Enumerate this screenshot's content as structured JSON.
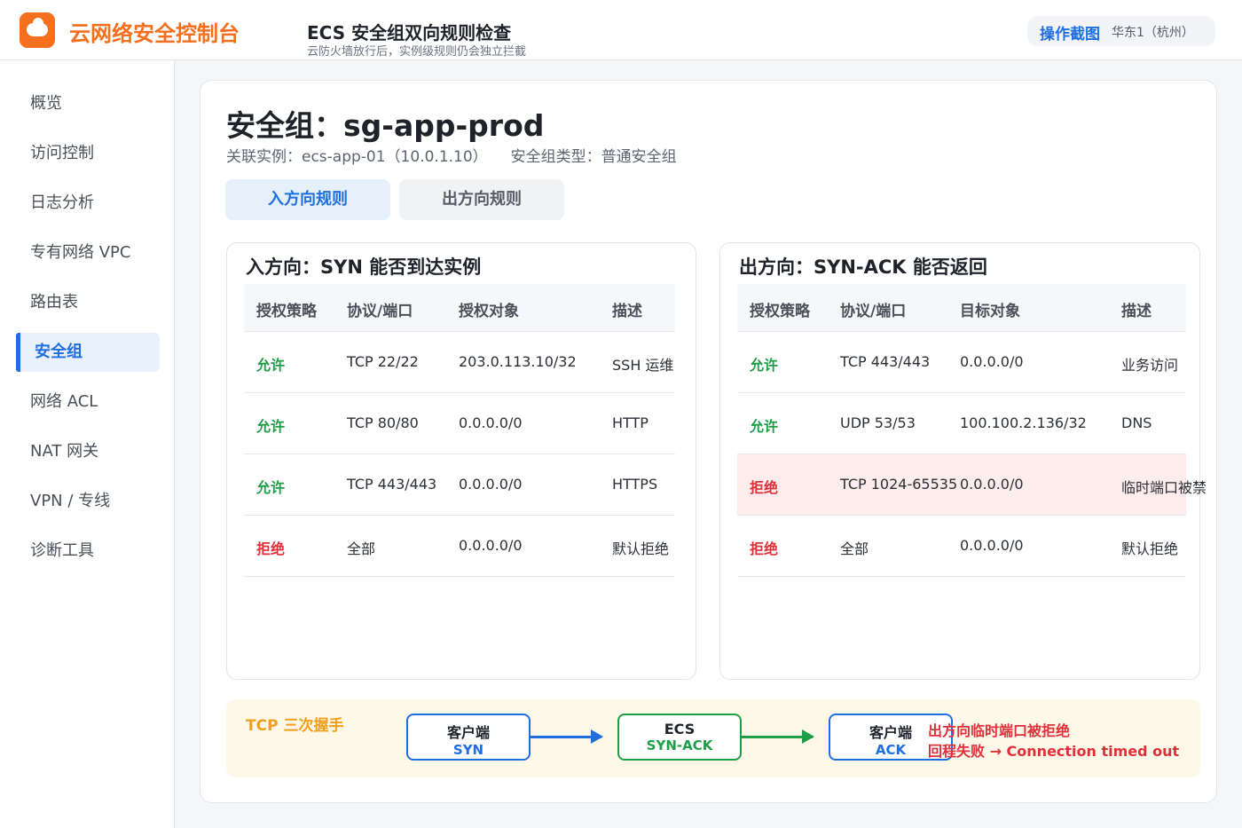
{
  "app": {
    "brand": "云网络安全控制台",
    "page_title": "ECS 安全组双向规则检查",
    "page_subtitle": "云防火墙放行后，实例级规则仍会独立拦截",
    "badge": "操作截图",
    "region": "华东1（杭州）"
  },
  "sidebar": {
    "items": [
      {
        "label": "概览",
        "active": false
      },
      {
        "label": "访问控制",
        "active": false
      },
      {
        "label": "日志分析",
        "active": false
      },
      {
        "label": "专有网络 VPC",
        "active": false
      },
      {
        "label": "路由表",
        "active": false
      },
      {
        "label": "安全组",
        "active": true
      },
      {
        "label": "网络 ACL",
        "active": false
      },
      {
        "label": "NAT 网关",
        "active": false
      },
      {
        "label": "VPN / 专线",
        "active": false
      },
      {
        "label": "诊断工具",
        "active": false
      }
    ]
  },
  "security_group": {
    "title": "安全组：sg-app-prod",
    "instance": "关联实例：ecs-app-01（10.0.1.10）",
    "type": "安全组类型：普通安全组"
  },
  "tabs": {
    "inbound": "入方向规则",
    "outbound": "出方向规则",
    "active": "inbound"
  },
  "inbound": {
    "title": "入方向：SYN 能否到达实例",
    "headers": [
      "授权策略",
      "协议/端口",
      "授权对象",
      "描述"
    ],
    "rows": [
      {
        "policy": "允许",
        "port": "TCP 22/22",
        "target": "203.0.113.10/32",
        "desc": "SSH 运维"
      },
      {
        "policy": "允许",
        "port": "TCP 80/80",
        "target": "0.0.0.0/0",
        "desc": "HTTP"
      },
      {
        "policy": "允许",
        "port": "TCP 443/443",
        "target": "0.0.0.0/0",
        "desc": "HTTPS"
      },
      {
        "policy": "拒绝",
        "port": "全部",
        "target": "0.0.0.0/0",
        "desc": "默认拒绝"
      }
    ]
  },
  "outbound": {
    "title": "出方向：SYN-ACK 能否返回",
    "headers": [
      "授权策略",
      "协议/端口",
      "目标对象",
      "描述"
    ],
    "rows": [
      {
        "policy": "允许",
        "port": "TCP 443/443",
        "target": "0.0.0.0/0",
        "desc": "业务访问"
      },
      {
        "policy": "允许",
        "port": "UDP 53/53",
        "target": "100.100.2.136/32",
        "desc": "DNS"
      },
      {
        "policy": "拒绝",
        "port": "TCP 1024-65535",
        "target": "0.0.0.0/0",
        "desc": "临时端口被禁",
        "highlight": true
      },
      {
        "policy": "拒绝",
        "port": "全部",
        "target": "0.0.0.0/0",
        "desc": "默认拒绝"
      }
    ]
  },
  "handshake": {
    "title": "TCP 三次握手",
    "nodes": [
      {
        "name": "客户端",
        "step": "SYN"
      },
      {
        "name": "ECS",
        "step": "SYN-ACK"
      },
      {
        "name": "客户端",
        "step": "ACK"
      }
    ],
    "failure_line1": "出方向临时端口被拒绝",
    "failure_line2": "回程失败 → Connection timed out"
  },
  "colors": {
    "brand": "#f46f1e",
    "accent": "#1f6fe0",
    "allow": "#1f9d47",
    "deny": "#e0303a",
    "highlight_row": "#fdecec",
    "strip_bg": "#fef8e9"
  }
}
